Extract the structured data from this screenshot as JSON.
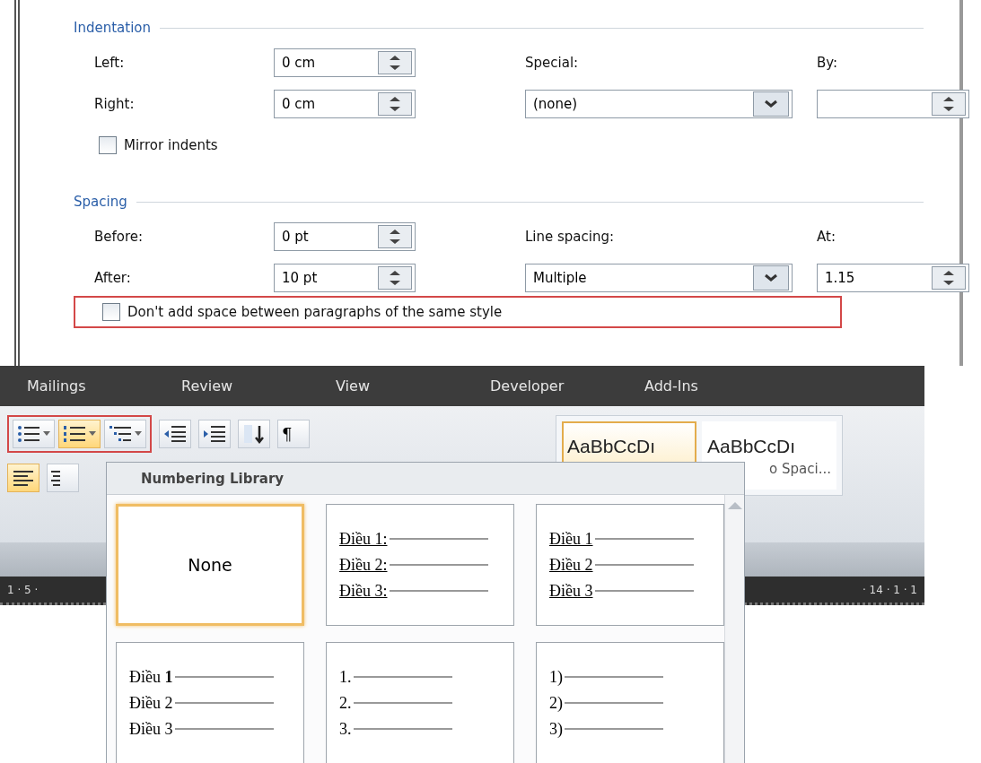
{
  "indentation": {
    "title": "Indentation",
    "left": {
      "label": "Left:",
      "value": "0 cm"
    },
    "right": {
      "label": "Right:",
      "value": "0 cm"
    },
    "special": {
      "label": "Special:",
      "value": "(none)"
    },
    "by": {
      "label": "By:"
    },
    "mirror": {
      "label": "Mirror indents",
      "checked": false
    }
  },
  "spacing": {
    "title": "Spacing",
    "before": {
      "label": "Before:",
      "value": "0 pt"
    },
    "after": {
      "label": "After:",
      "value": "10 pt"
    },
    "line_spacing": {
      "label": "Line spacing:",
      "value": "Multiple"
    },
    "at": {
      "label": "At:",
      "value": "1.15"
    },
    "dont_add": {
      "label": "Don't add space between paragraphs of the same style",
      "checked": false
    }
  },
  "ribbon": {
    "tabs": [
      {
        "label": "Mailings"
      },
      {
        "label": "Review"
      },
      {
        "label": "View"
      },
      {
        "label": "Developer"
      },
      {
        "label": "Add-Ins"
      }
    ],
    "list_tools": [
      {
        "kind": "bullets",
        "active": false
      },
      {
        "kind": "numbering",
        "active": true
      },
      {
        "kind": "multilevel",
        "active": false
      }
    ],
    "tools": [
      {
        "kind": "decrease-indent"
      },
      {
        "kind": "increase-indent"
      },
      {
        "kind": "sort"
      },
      {
        "kind": "pilcrow",
        "text": "¶"
      }
    ],
    "align_tools": [
      {
        "kind": "align-left",
        "active": true
      },
      {
        "kind": "align-center",
        "active": false
      }
    ],
    "styles": [
      {
        "sample": "AaBbCcDı",
        "selected": true
      },
      {
        "sample": "AaBbCcDı",
        "name": "o Spaci...",
        "selected": false
      }
    ],
    "ruler": {
      "left": "1 · 5 ·",
      "right": "· 14 · 1 · 1"
    }
  },
  "numbering": {
    "title": "Numbering Library",
    "items": [
      {
        "kind": "none",
        "label": "None",
        "selected": true
      },
      {
        "kind": "list",
        "underline": true,
        "lines": [
          "Điều 1:",
          "Điều 2:",
          "Điều 3:"
        ],
        "selected": false
      },
      {
        "kind": "list",
        "underline": true,
        "lines": [
          "Điều 1",
          "Điều 2",
          "Điều 3"
        ],
        "selected": false
      },
      {
        "kind": "list",
        "underline": false,
        "lines": [
          "Điều **1**",
          "Điều 2",
          "Điều 3"
        ],
        "selected": false
      },
      {
        "kind": "list",
        "underline": false,
        "lines": [
          "1.",
          "2.",
          "3."
        ],
        "selected": false
      },
      {
        "kind": "list",
        "underline": false,
        "lines": [
          "1)",
          "2)",
          "3)"
        ],
        "selected": false
      }
    ]
  }
}
